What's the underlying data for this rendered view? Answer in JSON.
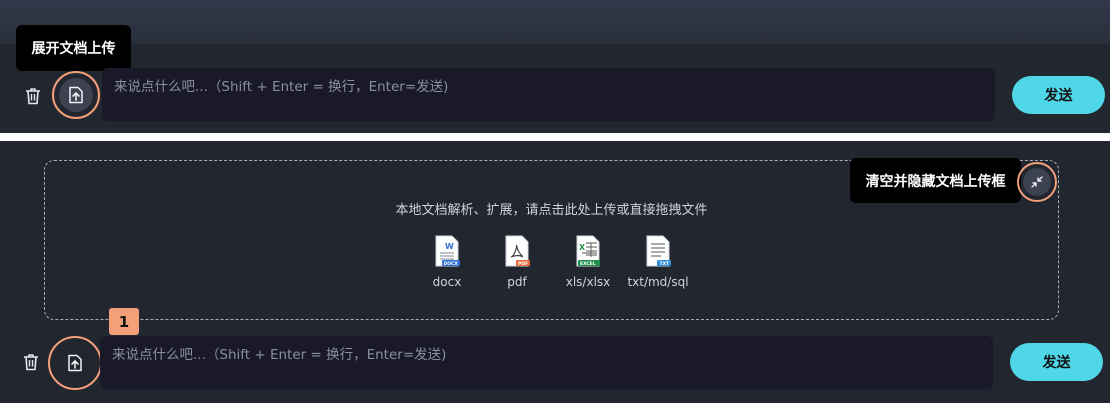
{
  "top": {
    "tooltip": "展开文档上传",
    "input_placeholder": "来说点什么吧...（Shift + Enter = 换行，Enter=发送)",
    "send_label": "发送"
  },
  "bottom": {
    "badge": "1",
    "tooltip": "清空并隐藏文档上传框",
    "drop_hint": "本地文档解析、扩展，请点击此处上传或直接拖拽文件",
    "file_types": [
      {
        "label": "docx",
        "tag": "DOCX",
        "color": "#2f6fd6",
        "glyph": "W"
      },
      {
        "label": "pdf",
        "tag": "PDF",
        "color": "#e86a3a",
        "glyph": ""
      },
      {
        "label": "xls/xlsx",
        "tag": "EXCEL",
        "color": "#1f8f4a",
        "glyph": "X"
      },
      {
        "label": "txt/md/sql",
        "tag": "TXT",
        "color": "#2f8fd6",
        "glyph": ""
      }
    ],
    "input_placeholder": "来说点什么吧...（Shift + Enter = 换行，Enter=发送)",
    "send_label": "发送"
  },
  "colors": {
    "accent": "#4fd7e8",
    "highlight": "#f2a079",
    "input_bg": "#191929"
  },
  "icons": {
    "trash": "trash-icon",
    "upload": "file-upload-icon",
    "collapse": "collapse-icon"
  }
}
